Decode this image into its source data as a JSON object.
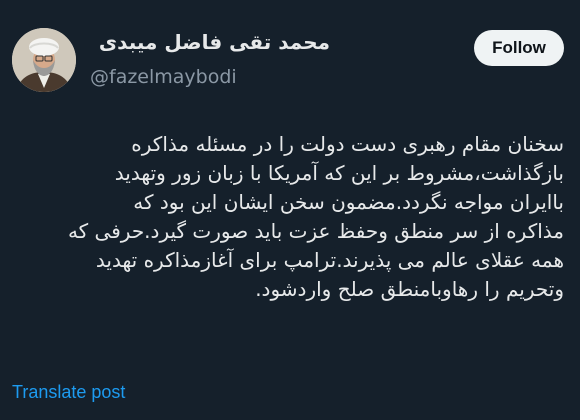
{
  "author": {
    "display_name": "محمد تقی فاضل میبدی",
    "handle": "@fazelmaybodi"
  },
  "follow_button": {
    "label": "Follow"
  },
  "tweet": {
    "lines": [
      "سخنان مقام رهبری دست دولت را در مسئله مذاکره",
      "بازگذاشت،مشروط بر این که آمریکا با زبان زور وتهدید",
      "باایران مواجه نگردد.مضمون سخن ایشان این بود که",
      "مذاکره از سر منطق وحفظ عزت باید صورت گیرد.حرفی که",
      "همه عقلای عالم می پذیرند.ترامپ برای آغازمذاکره تهدید",
      "وتحریم را رهاوبامنطق صلح واردشود."
    ]
  },
  "translate_link": {
    "label": "Translate post"
  },
  "colors": {
    "background": "#15202b",
    "text": "#e7e9ea",
    "secondary_text": "#8b98a5",
    "link": "#1d9bf0",
    "button_bg": "#eff3f4",
    "button_text": "#0f1419"
  },
  "icons": {
    "avatar": "profile-photo"
  }
}
